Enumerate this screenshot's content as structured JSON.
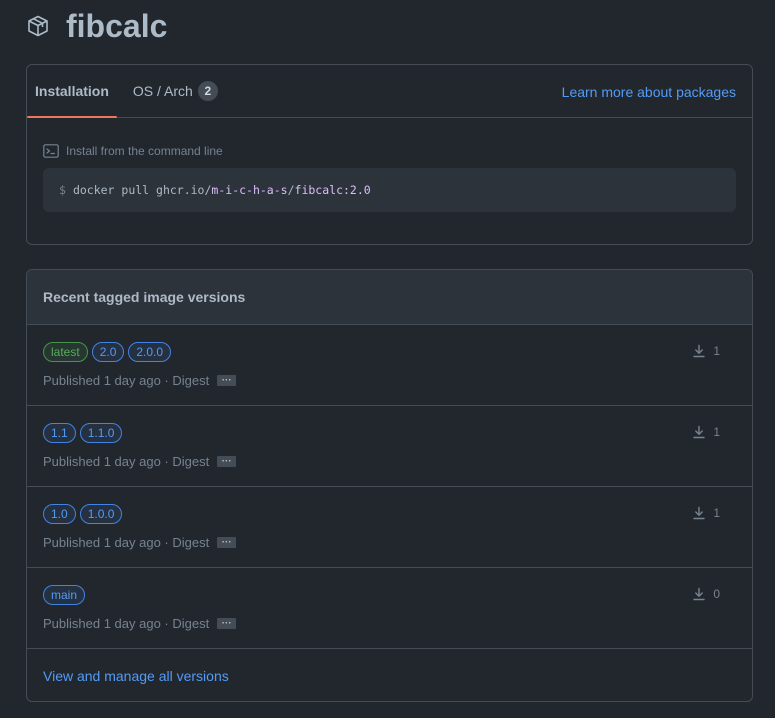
{
  "package": {
    "icon": "package-icon",
    "name": "fibcalc"
  },
  "install": {
    "tabs": [
      {
        "label": "Installation"
      },
      {
        "label": "OS / Arch",
        "count": "2"
      }
    ],
    "learn_more": "Learn more about packages",
    "command_label": "Install from the command line",
    "command": {
      "prompt": "$",
      "prefix": "docker pull ghcr.io/",
      "owner": "m-i-c-h-a-s",
      "slash": "/",
      "image": "fibcalc:2.0"
    }
  },
  "versions": {
    "heading": "Recent tagged image versions",
    "rows": [
      {
        "tags": [
          {
            "label": "latest",
            "style": "green"
          },
          {
            "label": "2.0"
          },
          {
            "label": "2.0.0"
          }
        ],
        "published": "Published 1 day ago · Digest",
        "digest": "···",
        "downloads": "1"
      },
      {
        "tags": [
          {
            "label": "1.1"
          },
          {
            "label": "1.1.0"
          }
        ],
        "published": "Published 1 day ago · Digest",
        "digest": "···",
        "downloads": "1"
      },
      {
        "tags": [
          {
            "label": "1.0"
          },
          {
            "label": "1.0.0"
          }
        ],
        "published": "Published 1 day ago · Digest",
        "digest": "···",
        "downloads": "1"
      },
      {
        "tags": [
          {
            "label": "main"
          }
        ],
        "published": "Published 1 day ago · Digest",
        "digest": "···",
        "downloads": "0"
      }
    ],
    "view_all": "View and manage all versions"
  },
  "colors": {
    "background": "#22272e",
    "border": "#444c56",
    "link": "#539bf5",
    "tab_underline": "#ec775c",
    "tag_green": "#57ab5a"
  }
}
